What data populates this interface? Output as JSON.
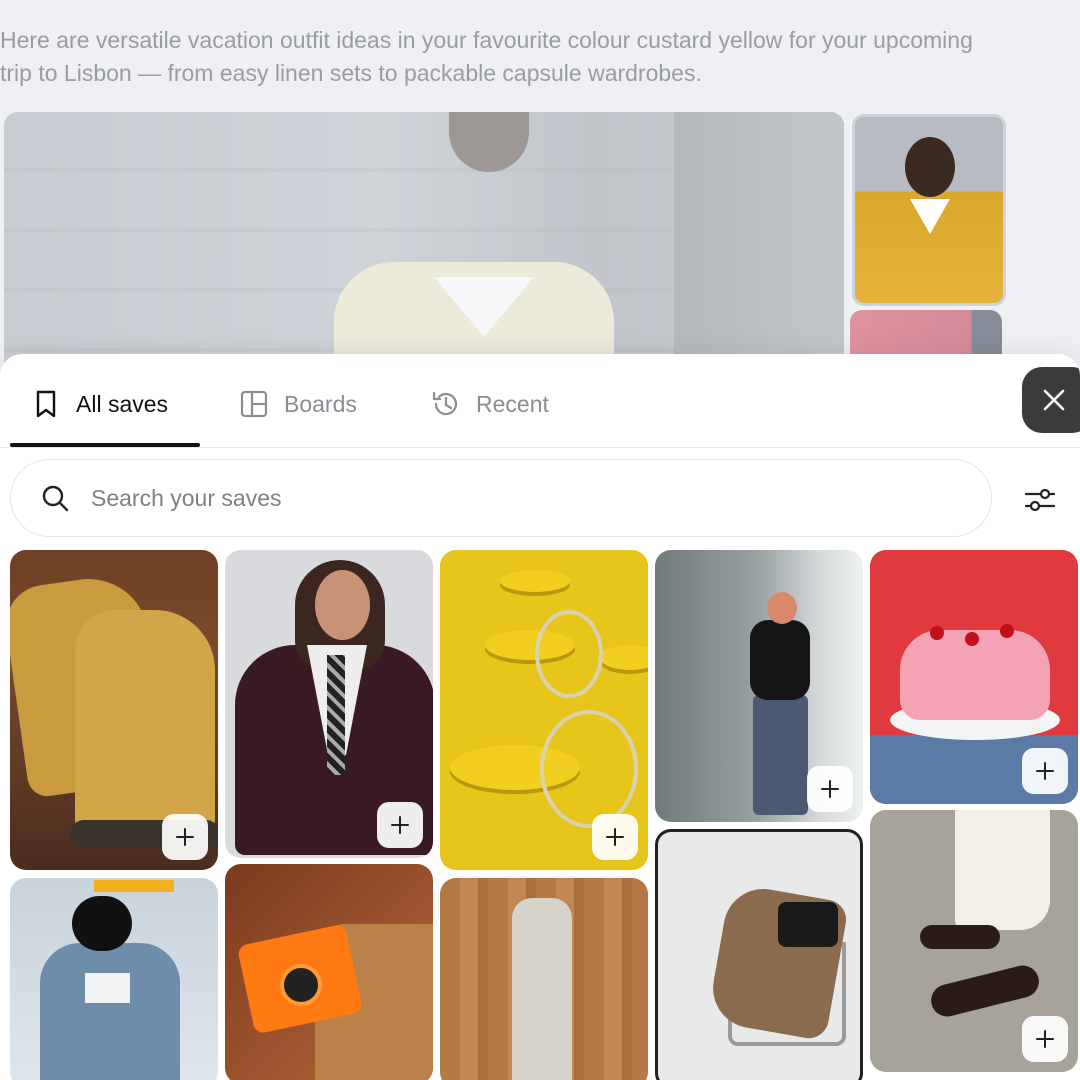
{
  "intro_text": "Here are versatile vacation outfit ideas in your favourite colour custard yellow for your upcoming trip to Lisbon — from easy linen sets to packable capsule wardrobes.",
  "tabs": [
    {
      "label": "All saves",
      "icon": "bookmark-icon",
      "active": true
    },
    {
      "label": "Boards",
      "icon": "board-layout-icon",
      "active": false
    },
    {
      "label": "Recent",
      "icon": "history-icon",
      "active": false
    }
  ],
  "search": {
    "placeholder": "Search your saves",
    "value": ""
  },
  "icons": {
    "close": "close-icon",
    "filter": "sliders-icon",
    "add": "plus-icon",
    "search": "search-icon"
  },
  "colors": {
    "accent": "#111111",
    "close_bg": "#3a3b3d",
    "panel_bg": "#ffffff",
    "page_bg": "#eef0f4"
  }
}
